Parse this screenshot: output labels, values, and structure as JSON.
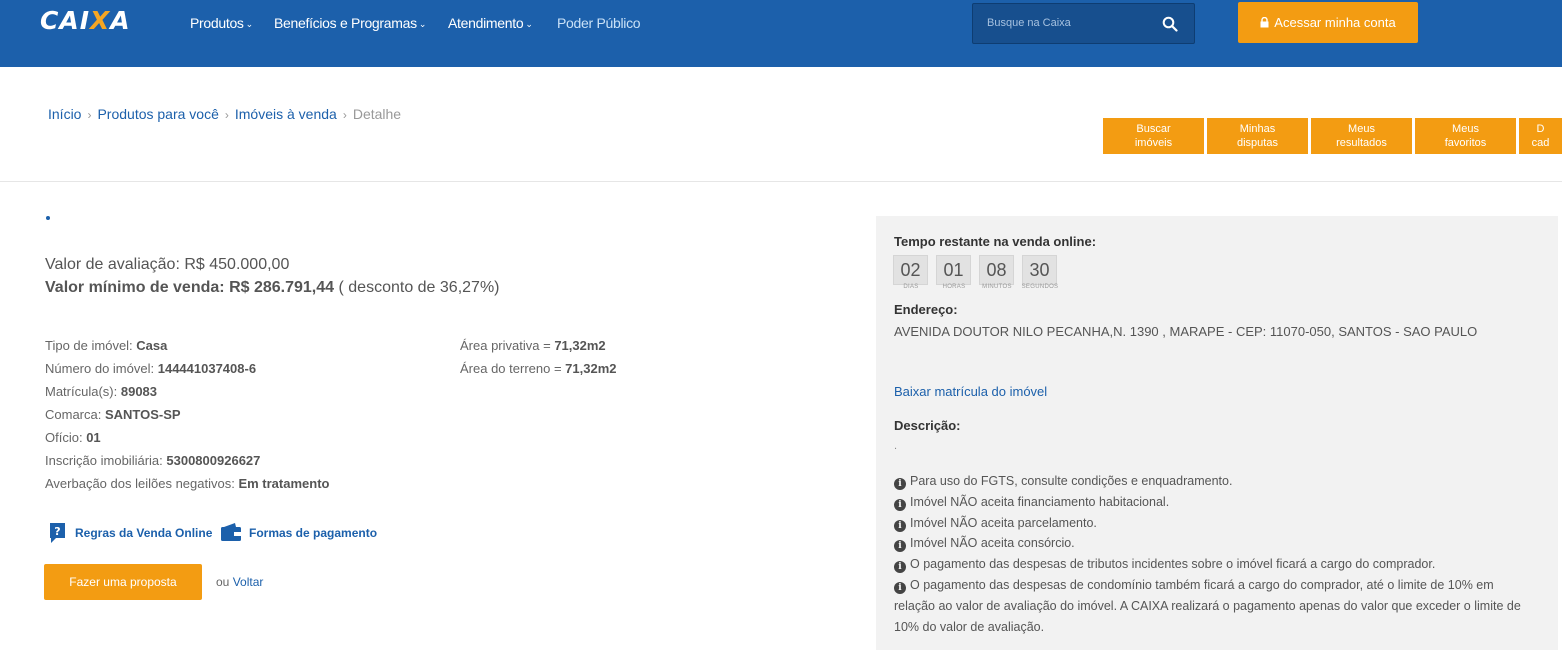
{
  "header": {
    "logo_text": "CAIXA",
    "nav": [
      {
        "label": "Produtos",
        "has_dropdown": true
      },
      {
        "label": "Benefícios e Programas",
        "has_dropdown": true
      },
      {
        "label": "Atendimento",
        "has_dropdown": true
      },
      {
        "label": "Poder Público",
        "has_dropdown": false
      }
    ],
    "search_placeholder": "Busque na Caixa",
    "account_button": "Acessar minha conta"
  },
  "breadcrumb": {
    "items": [
      "Início",
      "Produtos para você",
      "Imóveis à venda"
    ],
    "current": "Detalhe"
  },
  "action_tabs": [
    {
      "line1": "Buscar",
      "line2": "imóveis"
    },
    {
      "line1": "Minhas",
      "line2": "disputas"
    },
    {
      "line1": "Meus",
      "line2": "resultados"
    },
    {
      "line1": "Meus",
      "line2": "favoritos"
    },
    {
      "line1": "D",
      "line2": "cad"
    }
  ],
  "property": {
    "valor_avaliacao_label": "Valor de avaliação:",
    "valor_avaliacao": "R$ 450.000,00",
    "valor_minimo_label": "Valor mínimo de venda:",
    "valor_minimo": "R$ 286.791,44",
    "desconto": "( desconto de 36,27%)",
    "details_left": [
      {
        "label": "Tipo de imóvel:",
        "value": "Casa"
      },
      {
        "label": "Número do imóvel:",
        "value": "144441037408-6"
      },
      {
        "label": "Matrícula(s):",
        "value": "89083"
      },
      {
        "label": "Comarca:",
        "value": "SANTOS-SP"
      },
      {
        "label": "Ofício:",
        "value": "01"
      },
      {
        "label": "Inscrição imobiliária:",
        "value": "5300800926627"
      },
      {
        "label": "Averbação dos leilões negativos:",
        "value": "Em tratamento"
      }
    ],
    "details_right": [
      {
        "label": "Área privativa =",
        "value": "71,32m2"
      },
      {
        "label": "Área do terreno =",
        "value": "71,32m2"
      }
    ],
    "links": {
      "regras": "Regras da Venda Online",
      "pagamento": "Formas de pagamento"
    },
    "proposal_button": "Fazer uma proposta",
    "back_prefix": "ou",
    "back_link": "Voltar"
  },
  "panel": {
    "countdown_label": "Tempo restante na venda online:",
    "countdown": [
      {
        "value": "02",
        "unit": "DIAS"
      },
      {
        "value": "01",
        "unit": "HORAS"
      },
      {
        "value": "08",
        "unit": "MINUTOS"
      },
      {
        "value": "30",
        "unit": "SEGUNDOS"
      }
    ],
    "address_label": "Endereço:",
    "address": "AVENIDA DOUTOR NILO PECANHA,N. 1390 , MARAPE - CEP: 11070-050, SANTOS - SAO PAULO",
    "download_link": "Baixar matrícula do imóvel",
    "description_label": "Descrição:",
    "description_value": ".",
    "notes": [
      "Para uso do FGTS, consulte condições e enquadramento.",
      "Imóvel NÃO aceita financiamento habitacional.",
      "Imóvel NÃO aceita parcelamento.",
      "Imóvel NÃO aceita consórcio.",
      "O pagamento das despesas de tributos incidentes sobre o imóvel ficará a cargo do comprador.",
      "O pagamento das despesas de condomínio também ficará a cargo do comprador, até o limite de 10% em relação ao valor de avaliação do imóvel. A CAIXA realizará o pagamento apenas do valor que exceder o limite de 10% do valor de avaliação."
    ]
  },
  "colors": {
    "brand_blue": "#1c60ab",
    "accent_orange": "#f39c12",
    "panel_gray": "#f2f2f2"
  }
}
